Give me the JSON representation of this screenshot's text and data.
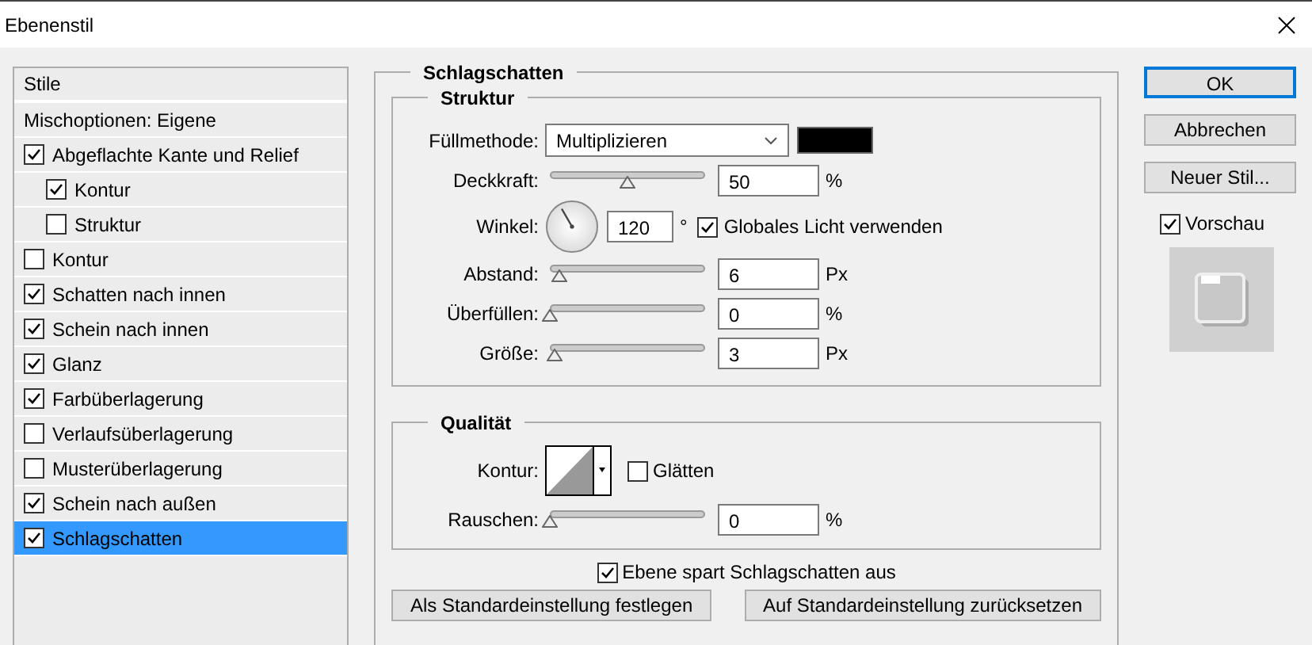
{
  "window": {
    "title": "Ebenenstil"
  },
  "styles": {
    "header": "Stile",
    "items": [
      {
        "kind": "plain",
        "label": "Mischoptionen: Eigene",
        "selected": false
      },
      {
        "kind": "check",
        "label": "Abgeflachte Kante und Relief",
        "checked": true,
        "selected": false,
        "children": [
          {
            "kind": "check",
            "label": "Kontur",
            "checked": true,
            "selected": false
          },
          {
            "kind": "check",
            "label": "Struktur",
            "checked": false,
            "selected": false
          }
        ]
      },
      {
        "kind": "check",
        "label": "Kontur",
        "checked": false,
        "selected": false
      },
      {
        "kind": "check",
        "label": "Schatten nach innen",
        "checked": true,
        "selected": false
      },
      {
        "kind": "check",
        "label": "Schein nach innen",
        "checked": true,
        "selected": false
      },
      {
        "kind": "check",
        "label": "Glanz",
        "checked": true,
        "selected": false
      },
      {
        "kind": "check",
        "label": "Farbüberlagerung",
        "checked": true,
        "selected": false
      },
      {
        "kind": "check",
        "label": "Verlaufsüberlagerung",
        "checked": false,
        "selected": false
      },
      {
        "kind": "check",
        "label": "Musterüberlagerung",
        "checked": false,
        "selected": false
      },
      {
        "kind": "check",
        "label": "Schein nach außen",
        "checked": true,
        "selected": false
      },
      {
        "kind": "check",
        "label": "Schlagschatten",
        "checked": true,
        "selected": true
      }
    ]
  },
  "panel": {
    "title": "Schlagschatten",
    "structure": {
      "title": "Struktur",
      "blend_mode": {
        "label": "Füllmethode:",
        "value": "Multiplizieren"
      },
      "opacity": {
        "label": "Deckkraft:",
        "level": 0.5,
        "value": "50",
        "unit": "%"
      },
      "angle": {
        "label": "Winkel:",
        "value": "120",
        "unit": "°",
        "global_light": {
          "label": "Globales Licht verwenden",
          "checked": true
        }
      },
      "distance": {
        "label": "Abstand:",
        "level": 0.06,
        "value": "6",
        "unit": "Px"
      },
      "spread": {
        "label": "Überfüllen:",
        "level": 0,
        "value": "0",
        "unit": "%"
      },
      "size": {
        "label": "Größe:",
        "level": 0.03,
        "value": "3",
        "unit": "Px"
      }
    },
    "quality": {
      "title": "Qualität",
      "contour": {
        "label": "Kontur:"
      },
      "antialias": {
        "label": "Glätten",
        "checked": false
      },
      "noise": {
        "label": "Rauschen:",
        "level": 0,
        "value": "0",
        "unit": "%"
      }
    },
    "knockout": {
      "label": "Ebene spart Schlagschatten aus",
      "checked": true
    },
    "buttons": [
      "Als Standardeinstellung festlegen",
      "Auf Standardeinstellung zurücksetzen"
    ]
  },
  "actions": [
    {
      "label": "OK",
      "default": true
    },
    {
      "label": "Abbrechen",
      "default": false
    },
    {
      "label": "Neuer Stil...",
      "default": false
    }
  ],
  "preview": {
    "label": "Vorschau",
    "checked": true
  }
}
